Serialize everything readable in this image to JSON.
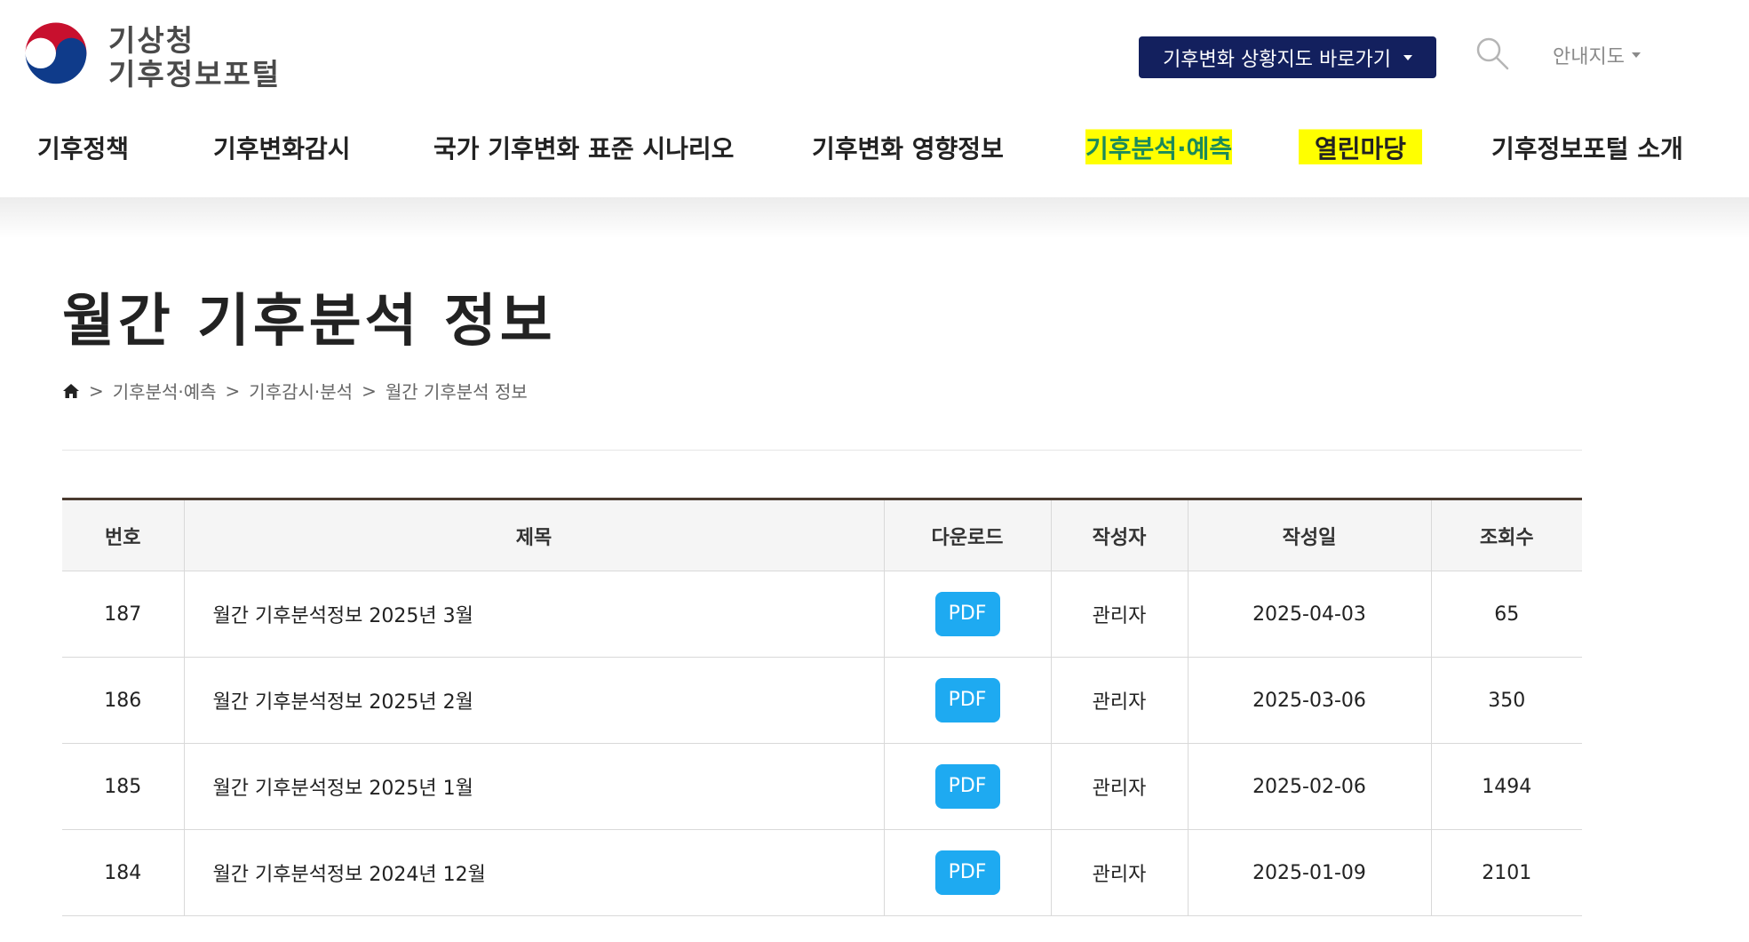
{
  "header": {
    "logo_line1": "기상청",
    "logo_line2": "기후정보포털",
    "shortcut_label": "기후변화 상황지도 바로가기",
    "guide_map_label": "안내지도",
    "brand_navy": "#13205e"
  },
  "nav": {
    "items": [
      {
        "label": "기후정책"
      },
      {
        "label": "기후변화감시"
      },
      {
        "label": "국가 기후변화 표준 시나리오"
      },
      {
        "label": "기후변화 영향정보"
      },
      {
        "label": "기후분석·예측"
      },
      {
        "label": "열린마당"
      },
      {
        "label": "기후정보포털 소개"
      }
    ]
  },
  "page": {
    "title": "월간 기후분석 정보",
    "breadcrumb": [
      "기후분석·예측",
      "기후감시·분석",
      "월간 기후분석 정보"
    ],
    "breadcrumb_sep": ">"
  },
  "table": {
    "headers": [
      "번호",
      "제목",
      "다운로드",
      "작성자",
      "작성일",
      "조회수"
    ],
    "rows": [
      {
        "no": "187",
        "title": "월간 기후분석정보 2025년 3월",
        "download": "PDF",
        "author": "관리자",
        "date": "2025-04-03",
        "views": "65"
      },
      {
        "no": "186",
        "title": "월간 기후분석정보 2025년 2월",
        "download": "PDF",
        "author": "관리자",
        "date": "2025-03-06",
        "views": "350"
      },
      {
        "no": "185",
        "title": "월간 기후분석정보 2025년 1월",
        "download": "PDF",
        "author": "관리자",
        "date": "2025-02-06",
        "views": "1494"
      },
      {
        "no": "184",
        "title": "월간 기후분석정보 2024년 12월",
        "download": "PDF",
        "author": "관리자",
        "date": "2025-01-09",
        "views": "2101"
      }
    ],
    "pdf_color": "#1eaaf1"
  }
}
